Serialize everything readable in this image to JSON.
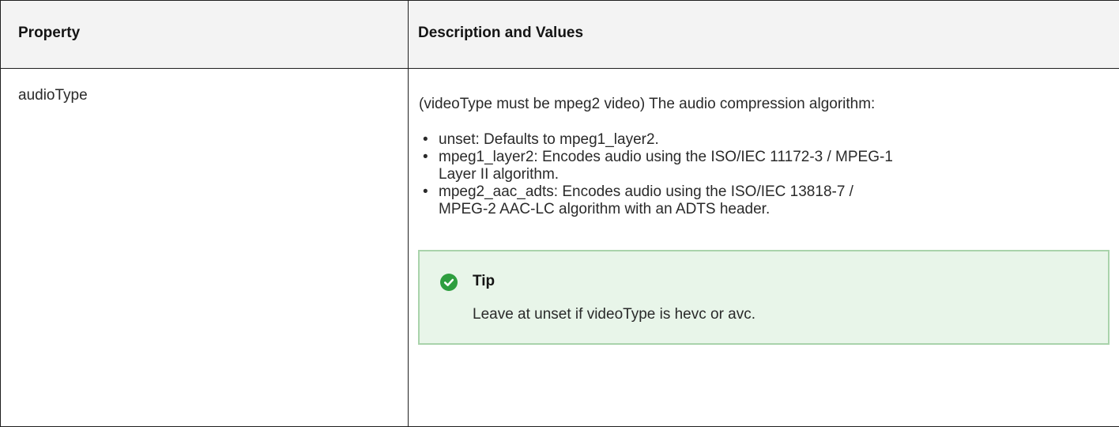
{
  "table": {
    "headers": {
      "property": "Property",
      "description": "Description and Values"
    },
    "row": {
      "property": "audioType",
      "intro": "(videoType must be mpeg2 video) The audio compression algorithm:",
      "values": [
        {
          "line1": "unset: Defaults to mpeg1_layer2.",
          "line2": ""
        },
        {
          "line1": "mpeg1_layer2: Encodes audio using the ISO/IEC 11172-3 / MPEG-1",
          "line2": "Layer II algorithm."
        },
        {
          "line1": "mpeg2_aac_adts: Encodes audio using the ISO/IEC 13818-7 /",
          "line2": "MPEG-2 AAC-LC algorithm with an ADTS header."
        }
      ],
      "tip": {
        "icon": "check-circle-icon",
        "title": "Tip",
        "body": "Leave at unset if videoType is hevc or avc."
      }
    }
  },
  "colors": {
    "tip_background": "#e8f5e9",
    "tip_border": "#a9d3ab",
    "tip_icon": "#2e9e3f",
    "header_background": "#f3f3f3"
  }
}
